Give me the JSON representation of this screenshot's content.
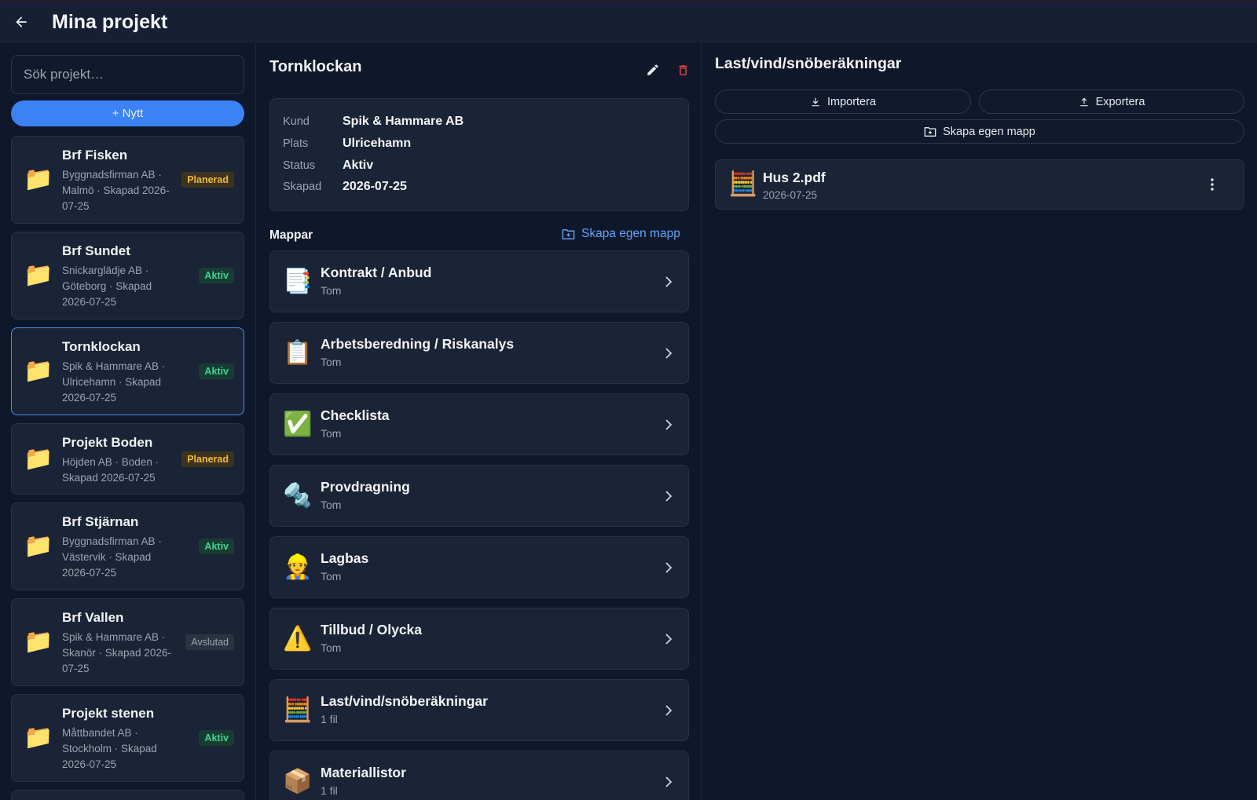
{
  "header": {
    "title": "Mina projekt",
    "back_icon": "arrow-left-icon"
  },
  "search": {
    "placeholder": "Sök projekt…"
  },
  "new_button": "+ Nytt",
  "projects": [
    {
      "name": "Brf Fisken",
      "meta": "Byggnadsfirman AB · Malmö · Skapad 2026-07-25",
      "status": "Planerad"
    },
    {
      "name": "Brf Sundet",
      "meta": "Snickarglädje AB · Göteborg · Skapad 2026-07-25",
      "status": "Aktiv"
    },
    {
      "name": "Tornklockan",
      "meta": "Spik & Hammare AB · Ulricehamn · Skapad 2026-07-25",
      "status": "Aktiv"
    },
    {
      "name": "Projekt Boden",
      "meta": "Höjden AB · Boden · Skapad 2026-07-25",
      "status": "Planerad"
    },
    {
      "name": "Brf Stjärnan",
      "meta": "Byggnadsfirman AB · Västervik · Skapad 2026-07-25",
      "status": "Aktiv"
    },
    {
      "name": "Brf Vallen",
      "meta": "Spik & Hammare AB · Skanör · Skapad 2026-07-25",
      "status": "Avslutad"
    },
    {
      "name": "Projekt stenen",
      "meta": "Måttbandet AB · Stockholm · Skapad 2026-07-25",
      "status": "Aktiv"
    }
  ],
  "project_detail": {
    "title": "Tornklockan",
    "info": [
      {
        "label": "Kund",
        "value": "Spik & Hammare AB"
      },
      {
        "label": "Plats",
        "value": "Ulricehamn"
      },
      {
        "label": "Status",
        "value": "Aktiv"
      },
      {
        "label": "Skapad",
        "value": "2026-07-25"
      }
    ],
    "folders_label": "Mappar",
    "create_folder": "Skapa egen mapp",
    "folders": [
      {
        "name": "Kontrakt / Anbud",
        "sub": "Tom",
        "icon": "📑"
      },
      {
        "name": "Arbetsberedning / Riskanalys",
        "sub": "Tom",
        "icon": "📋"
      },
      {
        "name": "Checklista",
        "sub": "Tom",
        "icon": "✅"
      },
      {
        "name": "Provdragning",
        "sub": "Tom",
        "icon": "🔩"
      },
      {
        "name": "Lagbas",
        "sub": "Tom",
        "icon": "👷"
      },
      {
        "name": "Tillbud / Olycka",
        "sub": "Tom",
        "icon": "⚠️"
      },
      {
        "name": "Last/vind/snöberäkningar",
        "sub": "1 fil",
        "icon": "🧮"
      },
      {
        "name": "Materiallistor",
        "sub": "1 fil",
        "icon": "📦"
      }
    ]
  },
  "folder_view": {
    "title": "Last/vind/snöberäkningar",
    "import": "Importera",
    "export": "Exportera",
    "create_folder": "Skapa egen mapp",
    "files": [
      {
        "name": "Hus 2.pdf",
        "date": "2026-07-25",
        "icon": "🧮"
      }
    ]
  },
  "colors": {
    "accent": "#3b82f6",
    "link": "#60a5fa",
    "danger": "#ef4444",
    "bg": "#0f172a",
    "card": "#1b2436"
  }
}
